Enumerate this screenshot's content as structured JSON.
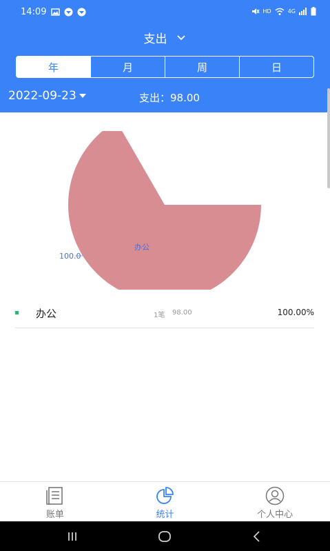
{
  "status_bar": {
    "time": "14:09",
    "network": "4G",
    "hd": "HD"
  },
  "header": {
    "title": "支出",
    "tabs": [
      {
        "label": "年",
        "active": true
      },
      {
        "label": "月",
        "active": false
      },
      {
        "label": "周",
        "active": false
      },
      {
        "label": "日",
        "active": false
      }
    ],
    "date": "2022-09-23",
    "total": "支出：98.00"
  },
  "chart_data": {
    "type": "pie",
    "slices": [
      {
        "label": "办公",
        "value": 100.0,
        "color": "#d88d93"
      }
    ],
    "value_label": "100.0"
  },
  "legend": [
    {
      "name": "办公",
      "count": "1笔",
      "amount": "98.00",
      "percent": "100.00%",
      "color": "#2bb673"
    }
  ],
  "bottom_nav": [
    {
      "label": "账单",
      "icon": "bill-icon",
      "active": false
    },
    {
      "label": "统计",
      "icon": "pie-chart-icon",
      "active": true
    },
    {
      "label": "个人中心",
      "icon": "user-icon",
      "active": false
    }
  ],
  "colors": {
    "primary": "#3a82f7",
    "slice": "#d88d93"
  }
}
